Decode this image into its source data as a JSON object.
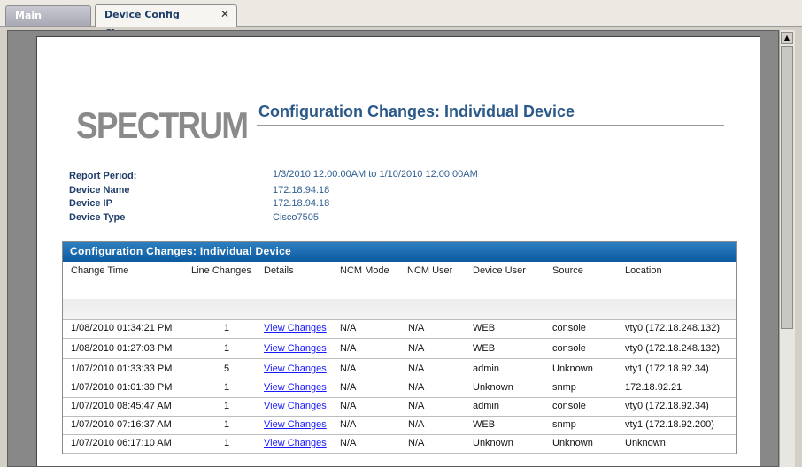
{
  "tabs": [
    {
      "label": "Main Report"
    },
    {
      "label": "Device Config Changes"
    }
  ],
  "close_glyph": "✕",
  "logo": "SPECTRUM",
  "report": {
    "title": "Configuration Changes: Individual Device",
    "meta": [
      {
        "label": "Report Period:",
        "value": "1/3/2010  12:00:00AM to 1/10/2010  12:00:00AM"
      },
      {
        "label": "Device Name",
        "value": "172.18.94.18"
      },
      {
        "label": "Device IP",
        "value": "172.18.94.18"
      },
      {
        "label": "Device Type",
        "value": "Cisco7505"
      }
    ]
  },
  "table": {
    "title": "Configuration Changes: Individual Device",
    "columns": [
      "Change Time",
      "Line Changes",
      "Details",
      "NCM Mode",
      "NCM User",
      "Device User",
      "Source",
      "Location"
    ],
    "rows": [
      {
        "time": "1/08/2010 01:34:21 PM",
        "lines": "1",
        "details": "View Changes",
        "mode": "N/A",
        "ncm_user": "N/A",
        "device_user": "WEB",
        "source": "console",
        "location": "vty0 (172.18.248.132)"
      },
      {
        "time": "1/08/2010 01:27:03 PM",
        "lines": "1",
        "details": "View Changes",
        "mode": "N/A",
        "ncm_user": "N/A",
        "device_user": "WEB",
        "source": "console",
        "location": "vty0 (172.18.248.132)"
      },
      {
        "time": "1/07/2010 01:33:33 PM",
        "lines": "5",
        "details": "View Changes",
        "mode": "N/A",
        "ncm_user": "N/A",
        "device_user": "admin",
        "source": "Unknown",
        "location": "vty1 (172.18.92.34)"
      },
      {
        "time": "1/07/2010 01:01:39 PM",
        "lines": "1",
        "details": "View Changes",
        "mode": "N/A",
        "ncm_user": "N/A",
        "device_user": "Unknown",
        "source": "snmp",
        "location": "172.18.92.21"
      },
      {
        "time": "1/07/2010 08:45:47 AM",
        "lines": "1",
        "details": "View Changes",
        "mode": "N/A",
        "ncm_user": "N/A",
        "device_user": "admin",
        "source": "console",
        "location": "vty0 (172.18.92.34)"
      },
      {
        "time": "1/07/2010 07:16:37 AM",
        "lines": "1",
        "details": "View Changes",
        "mode": "N/A",
        "ncm_user": "N/A",
        "device_user": "WEB",
        "source": "snmp",
        "location": "vty1 (172.18.92.200)"
      },
      {
        "time": "1/07/2010 06:17:10 AM",
        "lines": "1",
        "details": "View Changes",
        "mode": "N/A",
        "ncm_user": "N/A",
        "device_user": "Unknown",
        "source": "Unknown",
        "location": "Unknown"
      }
    ]
  },
  "scrollbar": {
    "up_arrow": "▲"
  },
  "colors": {
    "header_blue": "#0b5aa0",
    "title_blue": "#2b5a8a",
    "link": "#1a1aff",
    "logo_gray": "#8a8a8a"
  }
}
